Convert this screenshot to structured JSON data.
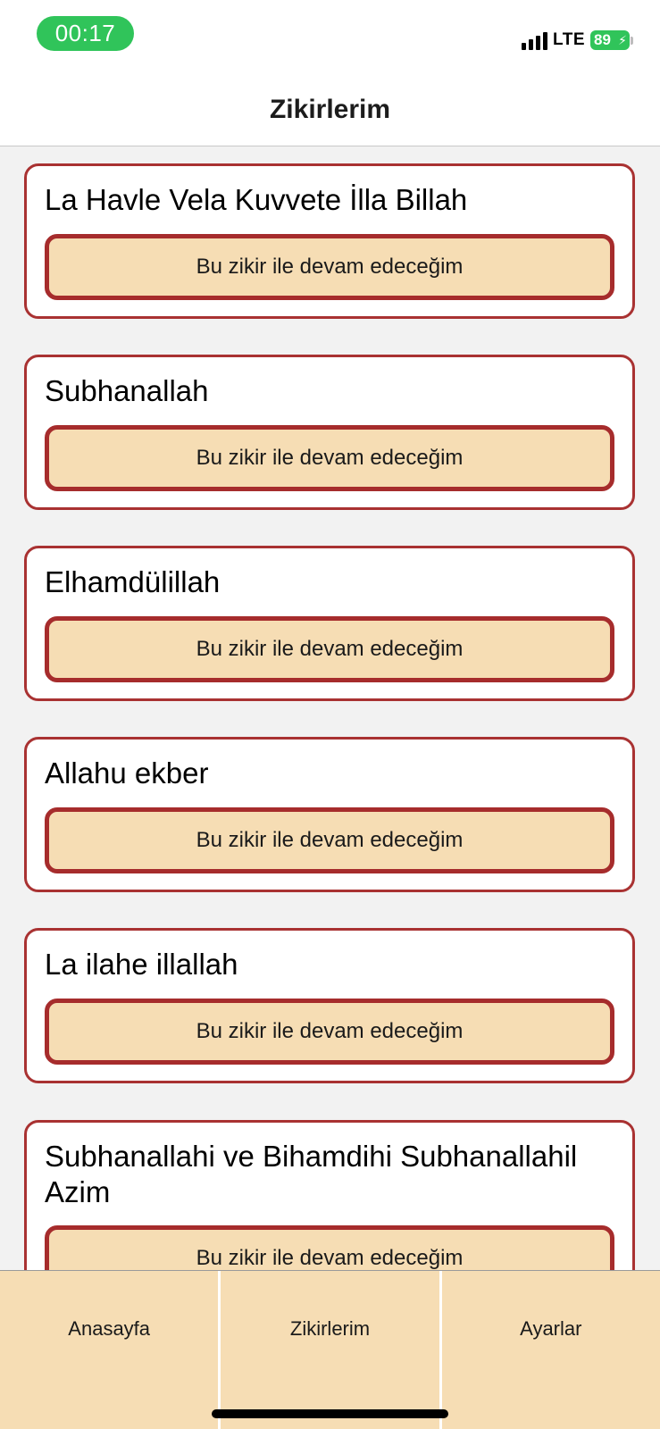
{
  "status_bar": {
    "time": "00:17",
    "network": "LTE",
    "battery": "89"
  },
  "header": {
    "title": "Zikirlerim"
  },
  "zikirs": [
    {
      "title": "La Havle Vela Kuvvete İlla Billah",
      "button_label": "Bu zikir ile devam edeceğim"
    },
    {
      "title": "Subhanallah",
      "button_label": "Bu zikir ile devam edeceğim"
    },
    {
      "title": "Elhamdülillah",
      "button_label": "Bu zikir ile devam edeceğim"
    },
    {
      "title": "Allahu ekber",
      "button_label": "Bu zikir ile devam edeceğim"
    },
    {
      "title": "La ilahe illallah",
      "button_label": "Bu zikir ile devam edeceğim"
    },
    {
      "title": "Subhanallahi ve Bihamdihi Subhanallahil Azim",
      "button_label": "Bu zikir ile devam edeceğim"
    }
  ],
  "tabbar": {
    "tabs": [
      {
        "label": "Anasayfa"
      },
      {
        "label": "Zikirlerim"
      },
      {
        "label": "Ayarlar"
      }
    ]
  },
  "colors": {
    "accent_border": "#a93232",
    "button_fill": "#f6ddb4",
    "time_pill": "#30c45a"
  }
}
